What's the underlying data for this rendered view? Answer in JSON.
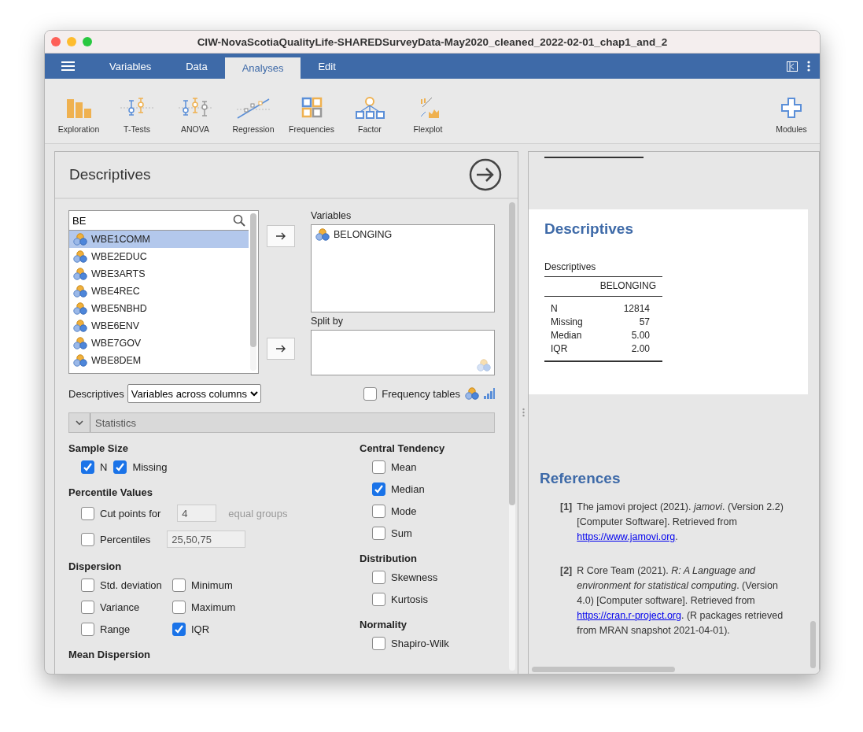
{
  "window": {
    "title": "CIW-NovaScotiaQualityLife-SHAREDSurveyData-May2020_cleaned_2022-02-01_chap1_and_2"
  },
  "menu_tabs": [
    {
      "label": "Variables",
      "selected": false
    },
    {
      "label": "Data",
      "selected": false
    },
    {
      "label": "Analyses",
      "selected": true
    },
    {
      "label": "Edit",
      "selected": false
    }
  ],
  "toolbar": [
    {
      "label": "Exploration",
      "kind": "exploration"
    },
    {
      "label": "T-Tests",
      "kind": "ttests"
    },
    {
      "label": "ANOVA",
      "kind": "anova"
    },
    {
      "label": "Regression",
      "kind": "regression"
    },
    {
      "label": "Frequencies",
      "kind": "frequencies"
    },
    {
      "label": "Factor",
      "kind": "factor"
    },
    {
      "label": "Flexplot",
      "kind": "flexplot"
    }
  ],
  "modules": {
    "label": "Modules"
  },
  "analysis": {
    "title": "Descriptives",
    "search": {
      "value": "BE"
    },
    "variables": [
      {
        "name": "WBE1COMM",
        "selected": true
      },
      {
        "name": "WBE2EDUC",
        "selected": false
      },
      {
        "name": "WBE3ARTS",
        "selected": false
      },
      {
        "name": "WBE4REC",
        "selected": false
      },
      {
        "name": "WBE5NBHD",
        "selected": false
      },
      {
        "name": "WBE6ENV",
        "selected": false
      },
      {
        "name": "WBE7GOV",
        "selected": false
      },
      {
        "name": "WBE8DEM",
        "selected": false
      }
    ],
    "targets": [
      {
        "label": "Variables",
        "items": [
          "BELONGING"
        ]
      },
      {
        "label": "Split by"
      }
    ],
    "layout": {
      "label": "Descriptives",
      "value": "Variables across columns"
    },
    "frequency_tables": {
      "label": "Frequency tables",
      "checked": false
    },
    "section": {
      "label": "Statistics",
      "expanded": true
    },
    "left_groups": [
      {
        "title": "Sample Size",
        "kind": "inline",
        "options": [
          {
            "label": "N",
            "checked": true
          },
          {
            "label": "Missing",
            "checked": true
          }
        ]
      },
      {
        "title": "Percentile Values",
        "kind": "rows",
        "options": [
          {
            "label": "Cut points for",
            "checked": false,
            "value": "4",
            "suffix": "equal groups"
          },
          {
            "label": "Percentiles",
            "checked": false,
            "value": "25,50,75"
          }
        ]
      },
      {
        "title": "Dispersion",
        "kind": "grid",
        "options": [
          {
            "label": "Std. deviation",
            "checked": false
          },
          {
            "label": "Minimum",
            "checked": false
          },
          {
            "label": "Variance",
            "checked": false
          },
          {
            "label": "Maximum",
            "checked": false
          },
          {
            "label": "Range",
            "checked": false
          },
          {
            "label": "IQR",
            "checked": true
          }
        ]
      },
      {
        "title": "Mean Dispersion"
      }
    ],
    "right_groups": [
      {
        "title": "Central Tendency",
        "kind": "rows",
        "options": [
          {
            "label": "Mean",
            "checked": false
          },
          {
            "label": "Median",
            "checked": true
          },
          {
            "label": "Mode",
            "checked": false
          },
          {
            "label": "Sum",
            "checked": false
          }
        ]
      },
      {
        "title": "Distribution",
        "kind": "rows",
        "options": [
          {
            "label": "Skewness",
            "checked": false
          },
          {
            "label": "Kurtosis",
            "checked": false
          }
        ]
      },
      {
        "title": "Normality",
        "kind": "rows",
        "options": [
          {
            "label": "Shapiro-Wilk",
            "checked": false
          }
        ]
      }
    ]
  },
  "results": {
    "title": "Descriptives",
    "table": {
      "title": "Descriptives",
      "columns": [
        "BELONGING"
      ],
      "rows": [
        {
          "label": "N",
          "value": "12814"
        },
        {
          "label": "Missing",
          "value": "57"
        },
        {
          "label": "Median",
          "value": "5.00"
        },
        {
          "label": "IQR",
          "value": "2.00"
        }
      ]
    },
    "references_title": "References",
    "references": [
      {
        "number": "[1]",
        "before": "The jamovi project (2021). *jamovi*. (Version 2.2) [Computer Software]. Retrieved from",
        "link": "https://www.jamovi.org",
        "after": "."
      },
      {
        "number": "[2]",
        "before": "R Core Team (2021). *R: A Language and environment for statistical computing*. (Version 4.0) [Computer software]. Retrieved from",
        "link": "https://cran.r-project.org",
        "after": ". (R packages retrieved from MRAN snapshot 2021-04-01)."
      }
    ]
  }
}
